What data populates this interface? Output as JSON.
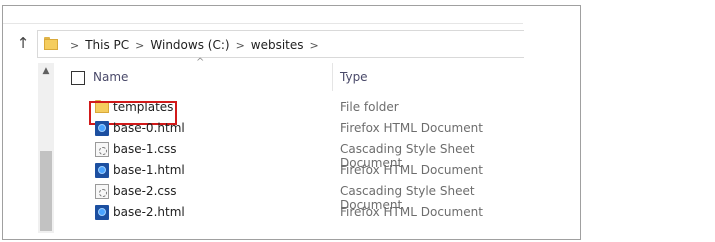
{
  "breadcrumb": {
    "items": [
      "This PC",
      "Windows (C:)",
      "websites"
    ]
  },
  "columns": {
    "name": "Name",
    "type": "Type"
  },
  "files": [
    {
      "name": "templates",
      "type": "File folder",
      "icon": "folder-icon"
    },
    {
      "name": "base-0.html",
      "type": "Firefox HTML Document",
      "icon": "html-file-icon"
    },
    {
      "name": "base-1.css",
      "type": "Cascading Style Sheet Document",
      "icon": "css-file-icon"
    },
    {
      "name": "base-1.html",
      "type": "Firefox HTML Document",
      "icon": "html-file-icon"
    },
    {
      "name": "base-2.css",
      "type": "Cascading Style Sheet Document",
      "icon": "css-file-icon"
    },
    {
      "name": "base-2.html",
      "type": "Firefox HTML Document",
      "icon": "html-file-icon"
    }
  ],
  "colors": {
    "highlight": "#d11a1a",
    "folder": "#f5cd5e",
    "html": "#1c4fa0"
  }
}
